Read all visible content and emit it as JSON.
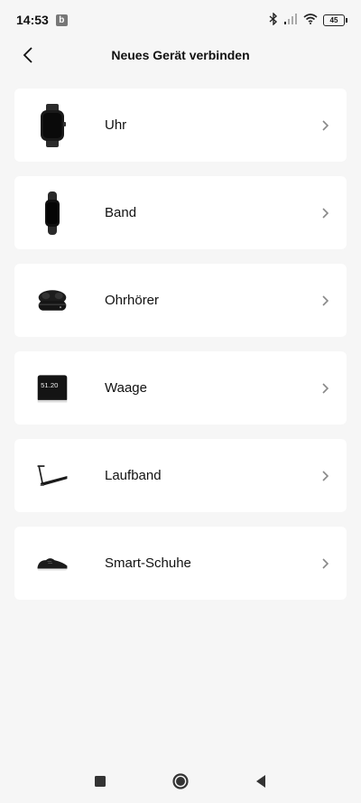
{
  "status": {
    "time": "14:53",
    "notification_badge": "b",
    "battery_level": "45"
  },
  "header": {
    "title": "Neues Gerät verbinden"
  },
  "devices": [
    {
      "label": "Uhr",
      "icon": "watch-icon"
    },
    {
      "label": "Band",
      "icon": "band-icon"
    },
    {
      "label": "Ohrhörer",
      "icon": "earbuds-icon"
    },
    {
      "label": "Waage",
      "icon": "scale-icon"
    },
    {
      "label": "Laufband",
      "icon": "treadmill-icon"
    },
    {
      "label": "Smart-Schuhe",
      "icon": "shoe-icon"
    }
  ],
  "scale_display": "51.20"
}
